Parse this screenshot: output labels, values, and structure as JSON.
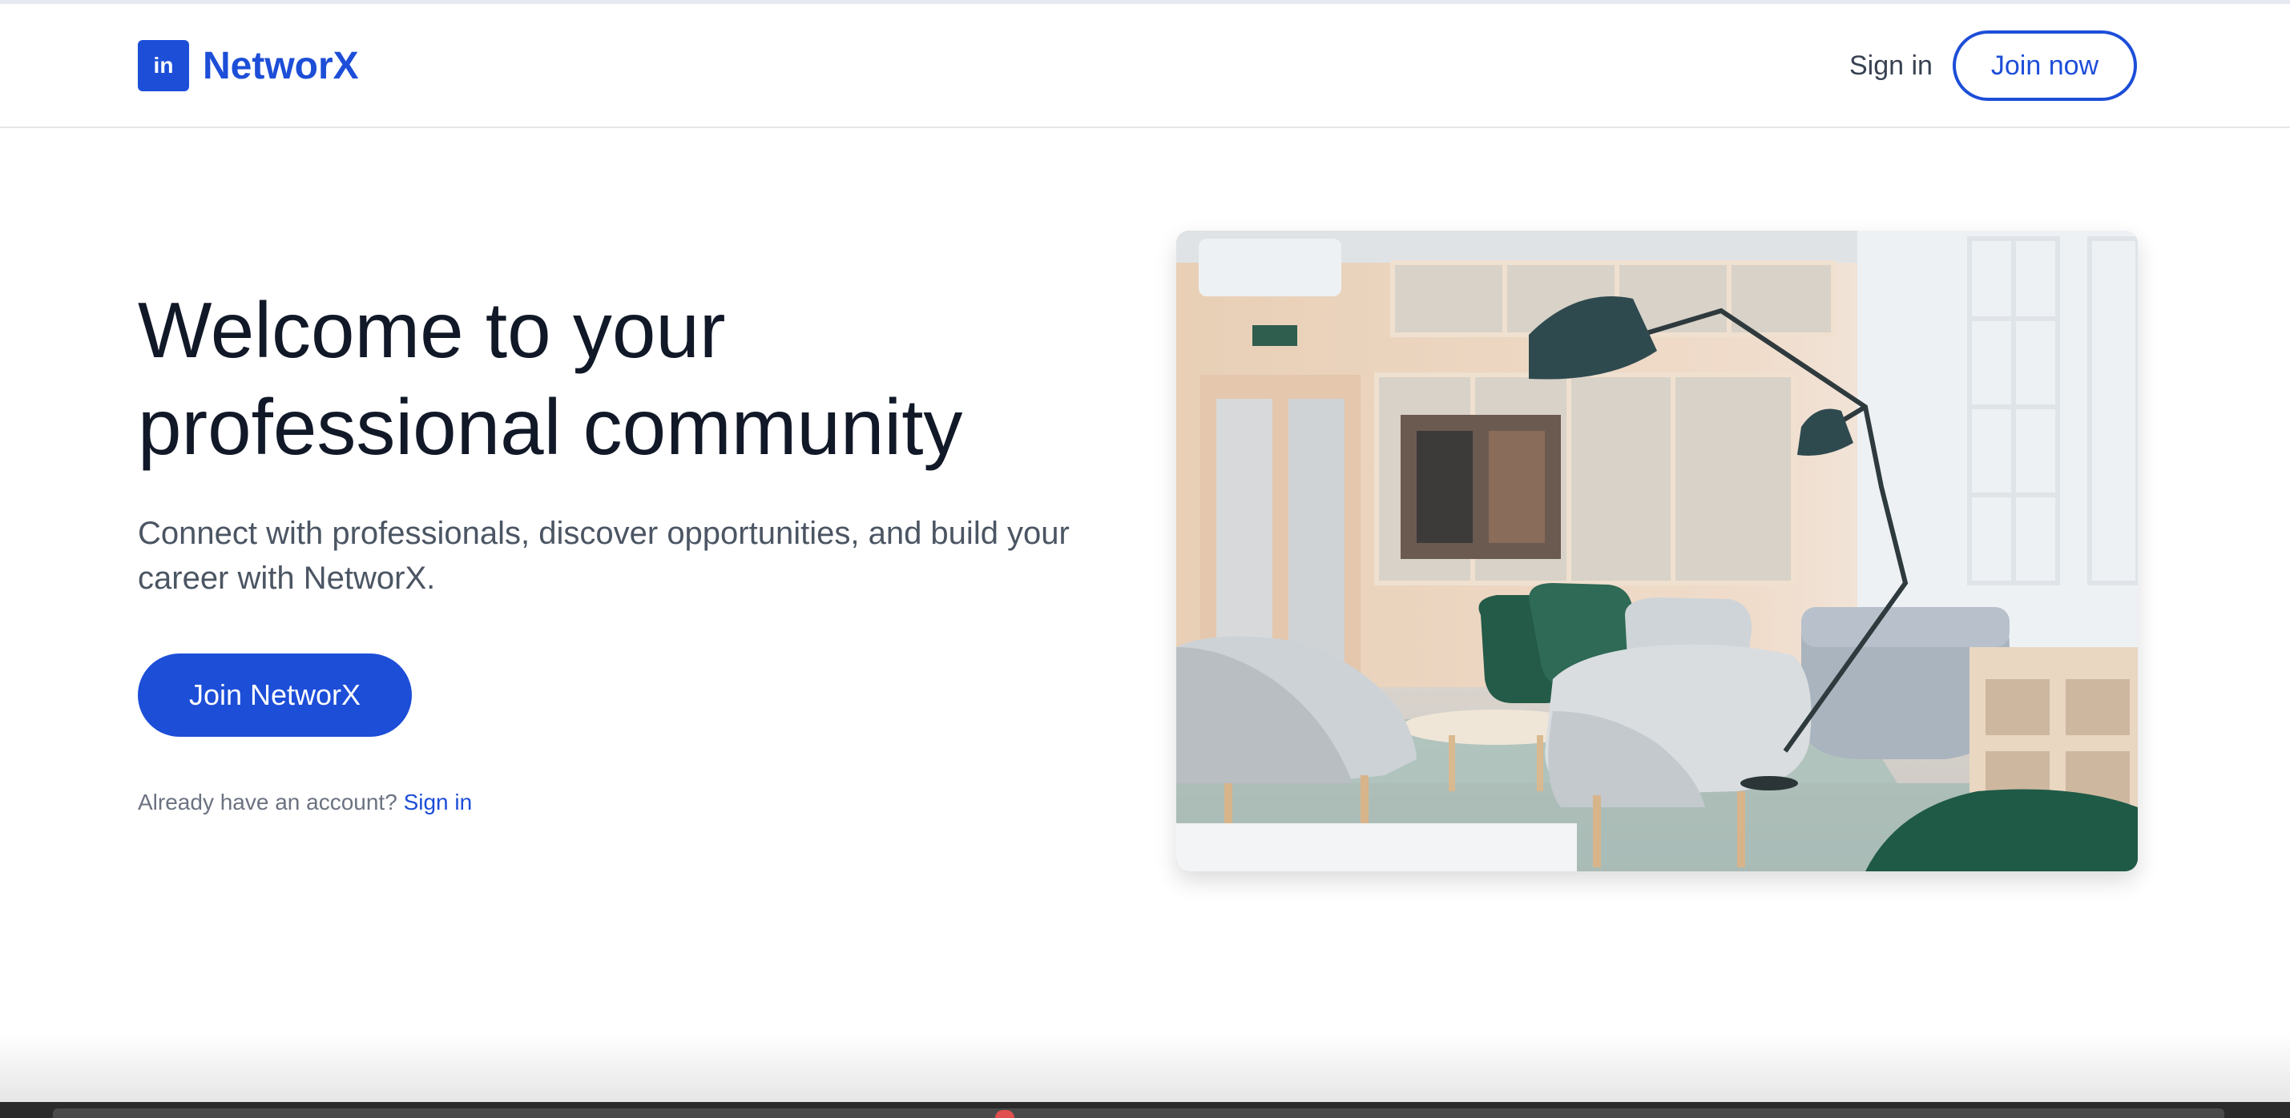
{
  "brand": {
    "logo_mark": "in",
    "name": "NetworX",
    "accent_color": "#1d4ed8"
  },
  "nav": {
    "signin_label": "Sign in",
    "join_label": "Join now"
  },
  "hero": {
    "title": "Welcome to your professional community",
    "subtitle": "Connect with professionals, discover opportunities, and build your career with NetworX.",
    "cta_label": "Join NetworX",
    "already_text": "Already have an account?",
    "signin_link": "Sign in",
    "image_alt": "office-lounge-photo"
  }
}
